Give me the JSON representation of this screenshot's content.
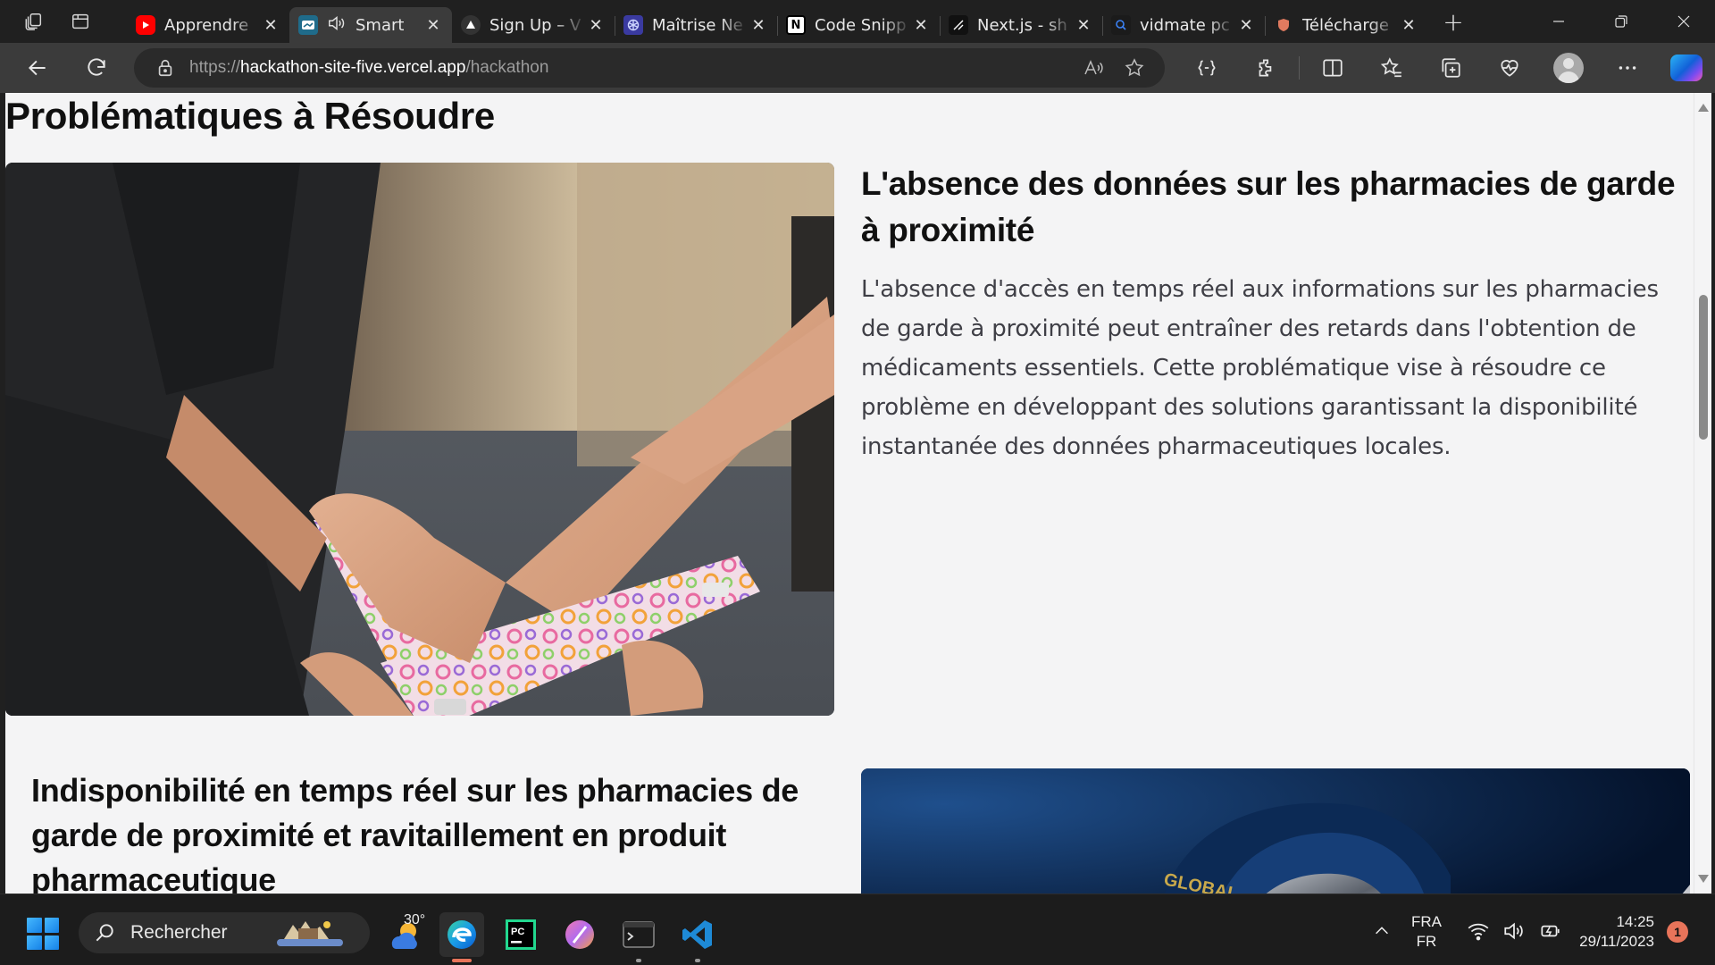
{
  "browser": {
    "tabs": [
      {
        "title": "Apprendre",
        "favicon": "youtube-icon",
        "color": "#ff0000"
      },
      {
        "title": "Smart",
        "favicon": "smart-icon",
        "color": "#1f6b8a",
        "active": true,
        "audio": true
      },
      {
        "title": "Sign Up – V",
        "favicon": "vercel-icon",
        "color": "#333333"
      },
      {
        "title": "Maîtrise Ne",
        "favicon": "openai-icon",
        "color": "#3a3aa0"
      },
      {
        "title": "Code Snipp",
        "favicon": "notion-icon",
        "color": "#ffffff"
      },
      {
        "title": "Next.js - sh",
        "favicon": "shadcn-icon",
        "color": "#111111"
      },
      {
        "title": "vidmate pc",
        "favicon": "search-icon",
        "color": "#1b1b1b"
      },
      {
        "title": "Télécharge",
        "favicon": "shield-icon",
        "color": "#6a4bb0"
      }
    ],
    "url": {
      "protocol": "https://",
      "host": "hackathon-site-five.vercel.app",
      "path": "/hackathon"
    }
  },
  "page": {
    "section_heading": "Problématiques à Résoudre",
    "problems": [
      {
        "title": "L'absence des données sur les pharmacies de garde à proximité",
        "description": "L'absence d'accès en temps réel aux informations sur les pharmacies de garde à proximité peut entraîner des retards dans l'obtention de médicaments essentiels. Cette problématique vise à résoudre ce problème en développant des solutions garantissant la disponibilité instantanée des données pharmaceutiques locales."
      },
      {
        "title": "Indisponibilité en temps réel sur les pharmacies de garde de proximité et ravitaillement en produit pharmaceutique"
      }
    ],
    "image2_brand": "GLOBAL"
  },
  "taskbar": {
    "search_placeholder": "Rechercher",
    "weather_temp": "30°",
    "lang_line1": "FRA",
    "lang_line2": "FR",
    "time": "14:25",
    "date": "29/11/2023",
    "notifications": "1"
  }
}
